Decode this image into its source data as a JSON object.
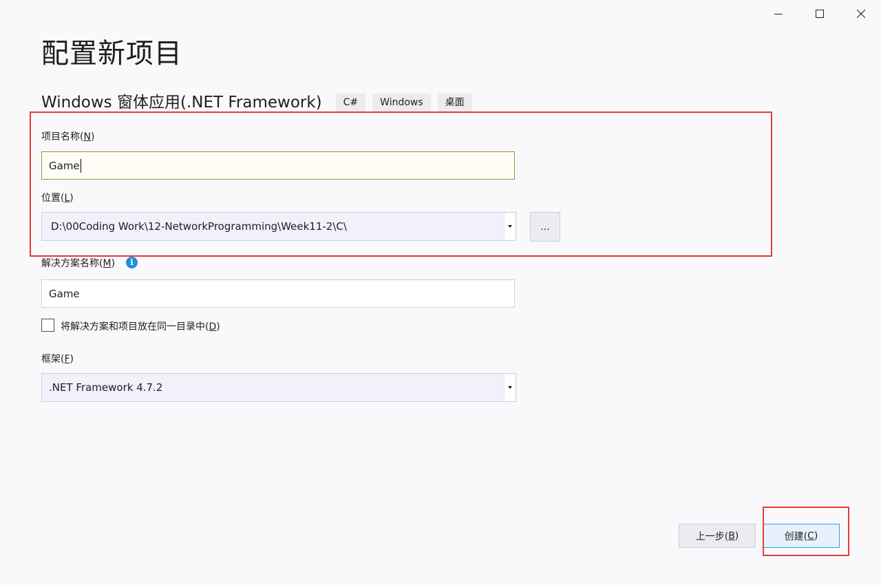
{
  "window": {
    "minimize_icon": "minimize-icon",
    "maximize_icon": "maximize-icon",
    "close_icon": "close-icon"
  },
  "header": {
    "title": "配置新项目",
    "template_name": "Windows 窗体应用(.NET Framework)",
    "tags": [
      "C#",
      "Windows",
      "桌面"
    ]
  },
  "project_name": {
    "label": "项目名称(",
    "access_key": "N",
    "label_end": ")",
    "value": "Game"
  },
  "location": {
    "label": "位置(",
    "access_key": "L",
    "label_end": ")",
    "value": "D:\\00Coding Work\\12-NetworkProgramming\\Week11-2\\C\\",
    "browse_label": "...",
    "dropdown_icon": "chevron-down-icon"
  },
  "solution_name": {
    "label": "解决方案名称(",
    "access_key": "M",
    "label_end": ")",
    "info_icon": "info-icon",
    "info_glyph": "i",
    "value": "Game"
  },
  "same_dir_checkbox": {
    "label": "将解决方案和项目放在同一目录中(",
    "access_key": "D",
    "label_end": ")",
    "checked": false
  },
  "framework": {
    "label": "框架(",
    "access_key": "F",
    "label_end": ")",
    "value": ".NET Framework 4.7.2",
    "dropdown_icon": "chevron-down-icon"
  },
  "footer": {
    "back_label": "上一步(",
    "back_key": "B",
    "back_end": ")",
    "create_label": "创建(",
    "create_key": "C",
    "create_end": ")"
  },
  "annotation_color": "#e53935"
}
